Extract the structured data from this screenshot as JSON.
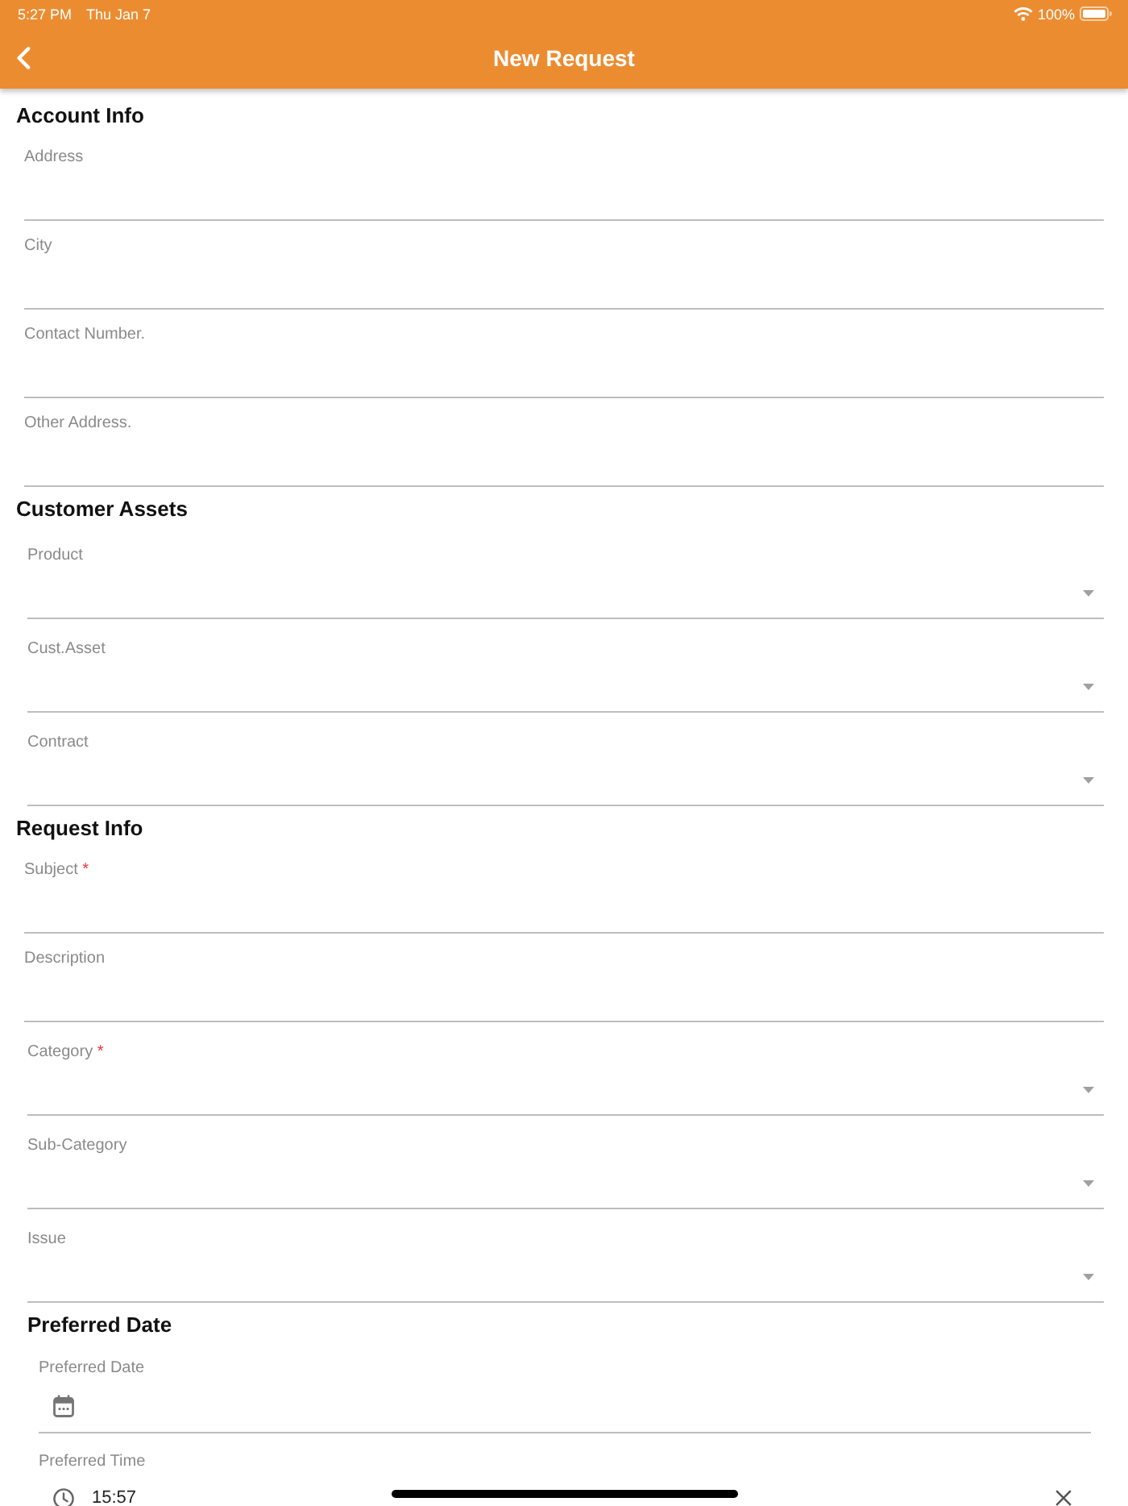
{
  "status_bar": {
    "time": "5:27 PM",
    "date": "Thu Jan 7",
    "battery": "100%"
  },
  "header": {
    "title": "New Request"
  },
  "sections": [
    {
      "title": "Account Info",
      "kind": "plain",
      "fields": [
        {
          "kind": "text",
          "label": "Address"
        },
        {
          "kind": "text",
          "label": "City"
        },
        {
          "kind": "text",
          "label": "Contact Number."
        },
        {
          "kind": "text",
          "label": "Other Address."
        }
      ]
    },
    {
      "title": "Customer Assets",
      "kind": "plain",
      "fields": [
        {
          "kind": "select",
          "label": "Product"
        },
        {
          "kind": "select",
          "label": "Cust.Asset"
        },
        {
          "kind": "select",
          "label": "Contract"
        }
      ]
    },
    {
      "title": "Request Info",
      "kind": "plain",
      "fields": [
        {
          "kind": "text",
          "label": "Subject",
          "required_mark": "*"
        },
        {
          "kind": "text",
          "label": "Description"
        },
        {
          "kind": "select",
          "label": "Category",
          "required_mark": "*"
        },
        {
          "kind": "select",
          "label": "Sub-Category"
        },
        {
          "kind": "select",
          "label": "Issue"
        }
      ]
    },
    {
      "title": "Preferred Date",
      "kind": "inset",
      "fields": [
        {
          "kind": "date",
          "label": "Preferred Date"
        },
        {
          "kind": "time",
          "label": "Preferred Time",
          "value": "15:57"
        }
      ]
    }
  ]
}
